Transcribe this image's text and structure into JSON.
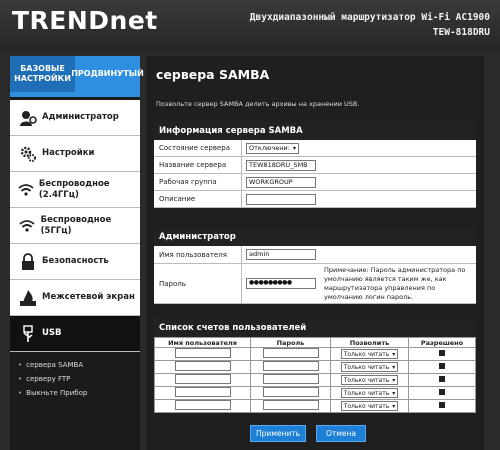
{
  "header": {
    "logo_text": "TRENDnet",
    "router_title": "Двухдиапазонный маршрутизатор Wi-Fi AC1900",
    "router_model": "TEW-818DRU"
  },
  "mode_tabs": {
    "basic": "БАЗОВЫЕ НАСТРОЙКИ",
    "advanced": "ПРОДВИНУТЫЙ"
  },
  "menu": [
    {
      "label": "Администратор",
      "icon": "admin-icon"
    },
    {
      "label": "Настройки",
      "icon": "gears-icon"
    },
    {
      "label": "Беспроводное (2.4ГГц)",
      "icon": "wifi-icon"
    },
    {
      "label": "Беспроводное (5ГГц)",
      "icon": "wifi-icon"
    },
    {
      "label": "Безопасность",
      "icon": "lock-icon"
    },
    {
      "label": "Межсетевой экран",
      "icon": "firewall-icon"
    },
    {
      "label": "USB",
      "icon": "usb-icon"
    }
  ],
  "submenu": [
    "сервера SAMBA",
    "серверу FTP",
    "Выкньте Прибор"
  ],
  "main": {
    "title": "сервера SAMBA",
    "description": "Позвольте сервер SAMBA делить архивы на хранении USB."
  },
  "server_info": {
    "heading": "Информация сервера SAMBA",
    "status_label": "Состояние сервера",
    "status_value": "Отключени:",
    "name_label": "Название сервера",
    "name_value": "TEW818DRU_SMB",
    "workgroup_label": "Рабочая группа",
    "workgroup_value": "WORKGROUP",
    "description_label": "Описание",
    "description_value": ""
  },
  "admin": {
    "heading": "Администратор",
    "username_label": "Имя пользователя",
    "username_value": "admin",
    "password_label": "Пароль",
    "password_value": "●●●●●●●●●",
    "note": "Примечание: Пароль администратора по умолчанию является таким же, как маршрутизатора управления по умолчанию логин пароль."
  },
  "user_list": {
    "heading": "Список счетов пользователей",
    "columns": [
      "Имя пользователя",
      "Пароль",
      "Позволить",
      "Разрешено"
    ],
    "permission_value": "Только читать",
    "row_count_label": ""
  },
  "buttons": {
    "apply": "Применить",
    "cancel": "Отмена"
  }
}
